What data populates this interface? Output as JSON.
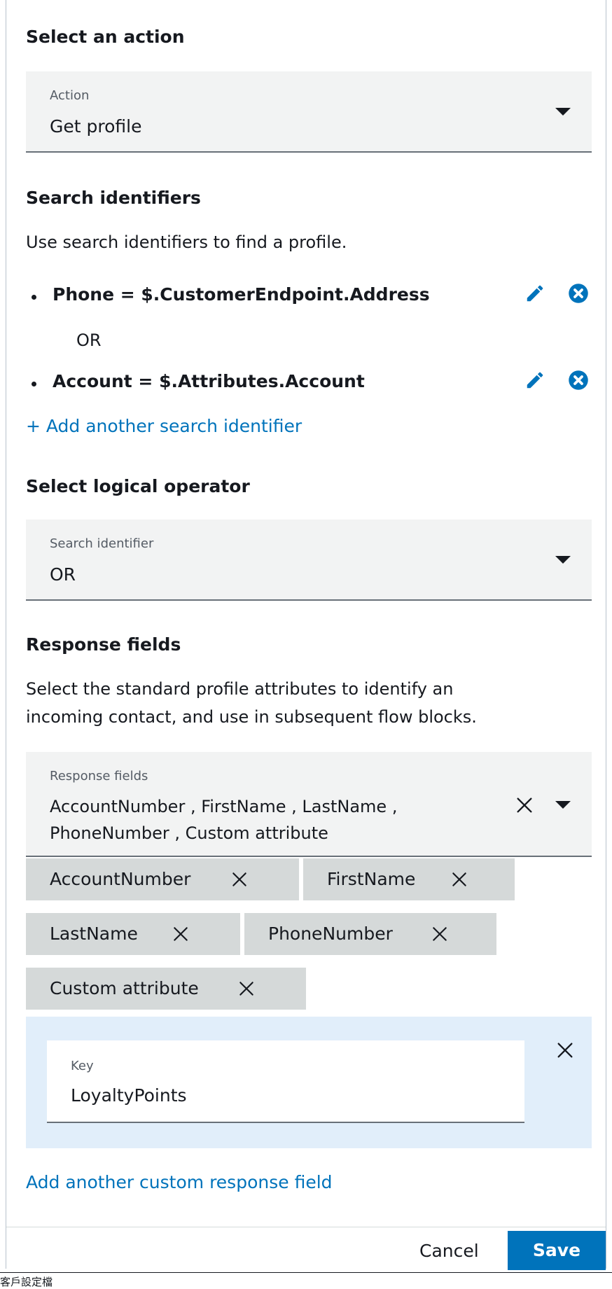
{
  "action_section": {
    "heading": "Select an action",
    "field_label": "Action",
    "value": "Get profile"
  },
  "search_section": {
    "heading": "Search identifiers",
    "description": "Use search identifiers to find a profile.",
    "identifiers": [
      {
        "text": "Phone = $.CustomerEndpoint.Address"
      },
      {
        "text": "Account = $.Attributes.Account"
      }
    ],
    "separator": "OR",
    "add_link": "+ Add another search identifier"
  },
  "operator_section": {
    "heading": "Select logical operator",
    "field_label": "Search identifier",
    "value": "OR"
  },
  "response_section": {
    "heading": "Response fields",
    "description_line1": "Select the standard profile attributes to identify an",
    "description_line2": "incoming contact, and use in subsequent flow blocks.",
    "field_label": "Response fields",
    "value_line1": "AccountNumber , FirstName , LastName ,",
    "value_line2": "PhoneNumber , Custom attribute",
    "chips": [
      {
        "label": "AccountNumber"
      },
      {
        "label": "FirstName"
      },
      {
        "label": "LastName"
      },
      {
        "label": "PhoneNumber"
      },
      {
        "label": "Custom attribute"
      }
    ]
  },
  "custom_attribute": {
    "key_label": "Key",
    "key_value": "LoyaltyPoints",
    "add_link": "Add another custom response field"
  },
  "footer": {
    "cancel_label": "Cancel",
    "save_label": "Save",
    "save_color": "#0073bb"
  },
  "bottom_caption": "客戶設定檔"
}
